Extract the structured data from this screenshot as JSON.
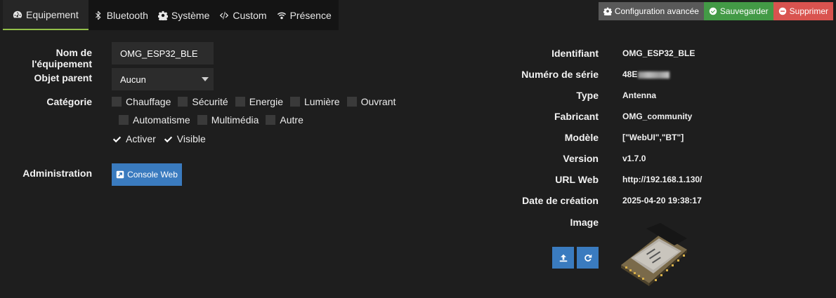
{
  "tabs": [
    {
      "label": "Equipement",
      "icon": "dashboard-icon",
      "active": true
    },
    {
      "label": "Bluetooth",
      "icon": "bluetooth-icon"
    },
    {
      "label": "Système",
      "icon": "cogs-icon"
    },
    {
      "label": "Custom",
      "icon": "code-icon"
    },
    {
      "label": "Présence",
      "icon": "wifi-icon"
    }
  ],
  "actions": {
    "advanced": "Configuration avancée",
    "save": "Sauvegarder",
    "delete": "Supprimer",
    "colors": {
      "advanced": "#595959",
      "save": "#439a46",
      "delete": "#d9534f"
    }
  },
  "form": {
    "name_label": "Nom de l'équipement",
    "name_value": "OMG_ESP32_BLE",
    "parent_label": "Objet parent",
    "parent_value": "Aucun",
    "category_label": "Catégorie",
    "categories_row1": [
      {
        "label": "Chauffage",
        "checked": false
      },
      {
        "label": "Sécurité",
        "checked": false
      },
      {
        "label": "Energie",
        "checked": false
      },
      {
        "label": "Lumière",
        "checked": false
      },
      {
        "label": "Ouvrant",
        "checked": false
      }
    ],
    "categories_row2": [
      {
        "label": "Automatisme",
        "checked": false
      },
      {
        "label": "Multimédia",
        "checked": false
      },
      {
        "label": "Autre",
        "checked": false
      }
    ],
    "activate_label": "Activer",
    "visible_label": "Visible",
    "admin_label": "Administration",
    "console_button": "Console Web"
  },
  "info": {
    "id_label": "Identifiant",
    "id_value": "OMG_ESP32_BLE",
    "serial_label": "Numéro de série",
    "serial_value": "48E",
    "type_label": "Type",
    "type_value": "Antenna",
    "maker_label": "Fabricant",
    "maker_value": "OMG_community",
    "model_label": "Modèle",
    "model_value": "[\"WebUI\",\"BT\"]",
    "version_label": "Version",
    "version_value": "v1.7.0",
    "url_label": "URL Web",
    "url_value": "http://192.168.1.130/",
    "date_label": "Date de création",
    "date_value": "2025-04-20 19:38:17",
    "image_label": "Image"
  },
  "accent": {
    "tab_active": "#93c04a",
    "primary": "#3a7bbf"
  }
}
